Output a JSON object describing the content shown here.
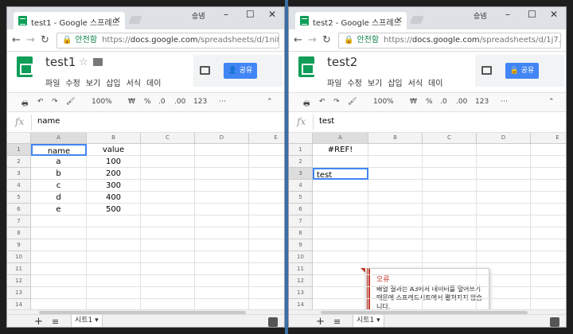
{
  "windows": [
    {
      "tab_title": "test1 - Google 스프레드",
      "user": "승넴",
      "secure_label": "안전함",
      "url_prefix": "https://",
      "url_host": "docs.google.com",
      "url_path": "/spreadsheets/d/1ni8...",
      "doc_title": "test1",
      "menu": [
        "파일",
        "수정",
        "보기",
        "삽입",
        "서식",
        "데이"
      ],
      "share_label": "공유",
      "toolbar": {
        "zoom": "100%",
        "currency": "₩",
        "percent": "%",
        "dec_less": ".0",
        "dec_more": ".00",
        "format": "123"
      },
      "formula": "name",
      "columns": [
        "A",
        "B",
        "C",
        "D",
        "E"
      ],
      "rows": [
        "1",
        "2",
        "3",
        "4",
        "5",
        "6",
        "7",
        "8",
        "9",
        "10",
        "11",
        "12",
        "13",
        "14"
      ],
      "cells": [
        [
          "name",
          "value"
        ],
        [
          "a",
          "100"
        ],
        [
          "b",
          "200"
        ],
        [
          "c",
          "300"
        ],
        [
          "d",
          "400"
        ],
        [
          "e",
          "500"
        ]
      ],
      "sheet_tab": "시트1"
    },
    {
      "tab_title": "test2 - Google 스프레드",
      "user": "승넴",
      "secure_label": "안전함",
      "url_prefix": "https://",
      "url_host": "docs.google.com",
      "url_path": "/spreadsheets/d/1j7...",
      "doc_title": "test2",
      "menu": [
        "파일",
        "수정",
        "보기",
        "삽입",
        "서식",
        "데이"
      ],
      "share_label": "공유",
      "toolbar": {
        "zoom": "100%",
        "currency": "₩",
        "percent": "%",
        "dec_less": ".0",
        "dec_more": ".00",
        "format": "123"
      },
      "formula": "test",
      "columns": [
        "A",
        "B",
        "C",
        "D",
        "E"
      ],
      "rows": [
        "1",
        "2",
        "3",
        "4",
        "5",
        "6",
        "7",
        "8",
        "9",
        "10",
        "11",
        "12",
        "13",
        "14"
      ],
      "cells": [
        [
          "#REF!"
        ],
        [
          ""
        ],
        [
          "test"
        ]
      ],
      "error": {
        "title": "오류",
        "message": "배열 결과는 A3에서 데이터를 덮어쓰기 때문에 스프레드시트에서 펼쳐지지 않습니다."
      },
      "sheet_tab": "시트1"
    }
  ],
  "colors": {
    "sheets_green": "#0f9d58",
    "share_blue": "#4285f4",
    "error_red": "#c53929",
    "selection_blue": "#4285f4"
  }
}
